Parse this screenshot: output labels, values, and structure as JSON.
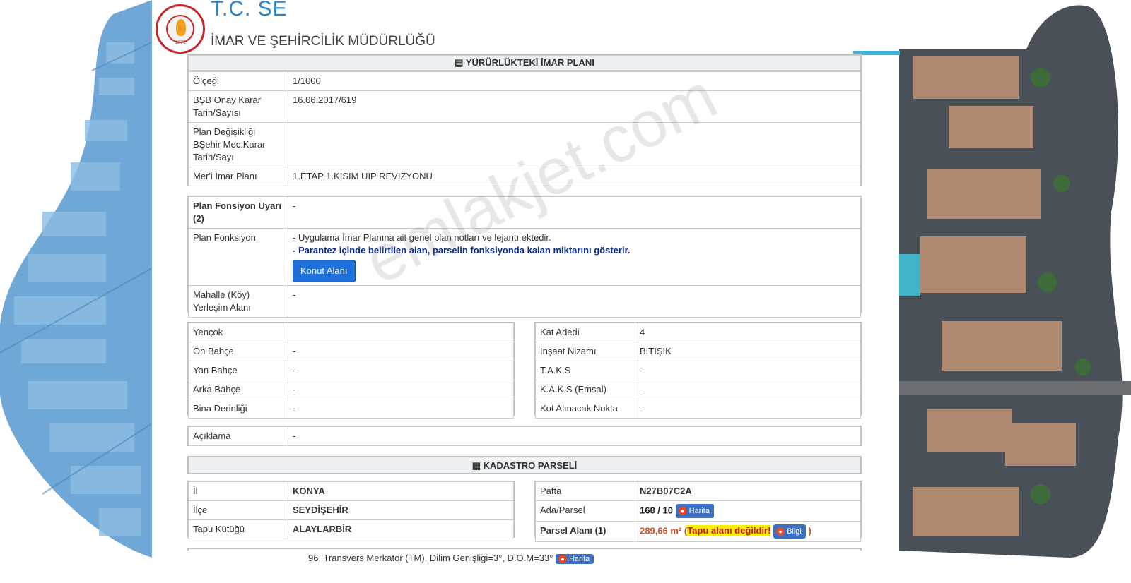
{
  "header": {
    "title_partial": "T.C. SE",
    "subtitle": "İMAR VE ŞEHİRCİLİK MÜDÜRLÜĞÜ",
    "logo_year": "1871",
    "logo_text": "SEYDİŞEHİR BELEDİYE BAŞKANLIĞI"
  },
  "plan_section": {
    "title": "YÜRÜRLÜKTEKİ İMAR PLANI",
    "rows": [
      {
        "label": "Ölçeği",
        "value": "1/1000"
      },
      {
        "label": "BŞB Onay Karar Tarih/Sayısı",
        "value": "16.06.2017/619"
      },
      {
        "label": "Plan Değişikliği BŞehir Mec.Karar Tarih/Sayı",
        "value": ""
      },
      {
        "label": "Mer'i İmar Planı",
        "value": "1.ETAP 1.KISIM UIP REVIZYONU"
      }
    ]
  },
  "function_section": {
    "warning_label": "Plan Fonsiyon Uyarı",
    "warning_sup": "(2)",
    "warning_value": "-",
    "function_label": "Plan Fonksiyon",
    "note1": "- Uygulama İmar Planına ait genel plan notları ve lejantı ektedir.",
    "note2": "- Parantez içinde belirtilen alan, parselin fonksiyonda kalan miktarını gösterir.",
    "button_label": "Konut Alanı",
    "mahalle_label": "Mahalle (Köy) Yerleşim Alanı",
    "mahalle_value": "-"
  },
  "left_details": [
    {
      "label": "Yençok",
      "value": ""
    },
    {
      "label": "Ön Bahçe",
      "value": "-"
    },
    {
      "label": "Yan Bahçe",
      "value": "-"
    },
    {
      "label": "Arka Bahçe",
      "value": "-"
    },
    {
      "label": "Bina Derinliği",
      "value": "-"
    }
  ],
  "right_details": [
    {
      "label": "Kat Adedi",
      "value": "4"
    },
    {
      "label": "İnşaat Nizamı",
      "value": "BİTİŞİK"
    },
    {
      "label": "T.A.K.S",
      "value": "-"
    },
    {
      "label": "K.A.K.S (Emsal)",
      "value": "-"
    },
    {
      "label": "Kot Alınacak Nokta",
      "value": "-"
    }
  ],
  "aciklama": {
    "label": "Açıklama",
    "value": "-"
  },
  "kadastro": {
    "title": "KADASTRO PARSELİ",
    "left": [
      {
        "label": "İl",
        "value": "KONYA"
      },
      {
        "label": "İlçe",
        "value": "SEYDİŞEHİR"
      },
      {
        "label": "Tapu Kütüğü",
        "value": "ALAYLARBİR"
      }
    ],
    "pafta_label": "Pafta",
    "pafta_value": "N27B07C2A",
    "ada_label": "Ada/Parsel",
    "ada_value": "168 / 10",
    "harita_label": "Harita",
    "parsel_label": "Parsel Alanı",
    "parsel_sup": "(1)",
    "parsel_value": "289,66 m²",
    "tapu_warning": "Tapu alanı değildir!",
    "bilgi_label": "Bilgi"
  },
  "footer": {
    "text": "96, Transvers Merkator (TM), Dilim Genişliği=3°, D.O.M=33°",
    "harita_label": "Harita"
  },
  "watermark": "emlakjet.com",
  "colors": {
    "accent_blue": "#1e6fd9",
    "warning_red": "#c8101c",
    "highlight_yellow": "#ffee00"
  }
}
